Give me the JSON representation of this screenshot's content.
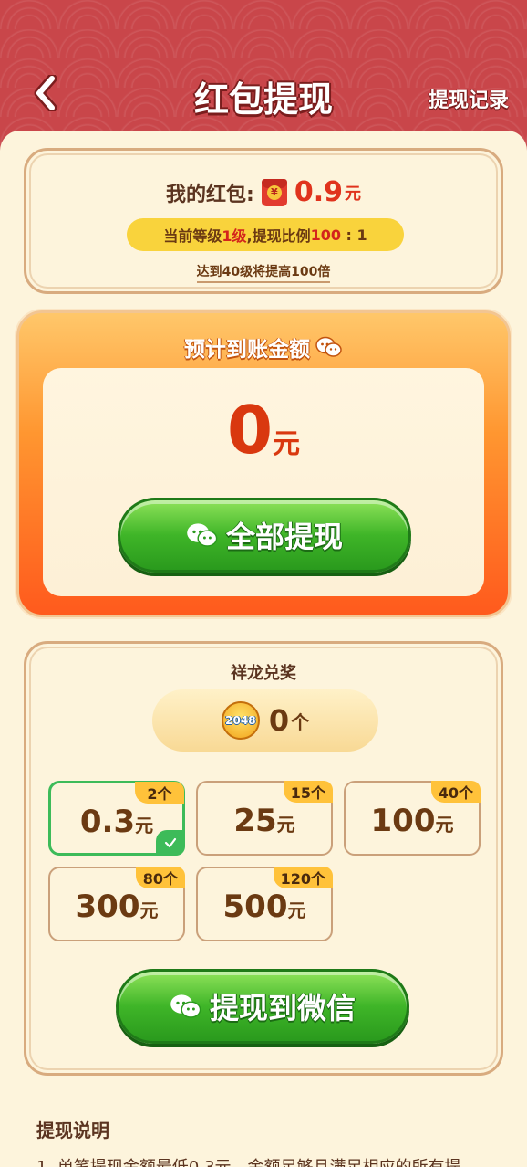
{
  "header": {
    "title": "红包提现",
    "history_label": "提现记录"
  },
  "balance": {
    "label": "我的红包:",
    "icon": "red-packet-icon",
    "amount": "0.9",
    "unit": "元",
    "level_prefix": "当前等级",
    "level_value": "1级",
    "level_mid": ",提现比例",
    "ratio_value": "100",
    "ratio_suffix": " : 1",
    "hint": "达到40级将提高100倍"
  },
  "payout": {
    "title": "预计到账金额",
    "amount": "0",
    "unit": "元",
    "button_label": "全部提现"
  },
  "exchange": {
    "title": "祥龙兑奖",
    "token_icon_text": "2048",
    "token_count": "0",
    "token_unit": "个",
    "options": [
      {
        "cost": "2个",
        "amount": "0.3",
        "unit": "元",
        "selected": true
      },
      {
        "cost": "15个",
        "amount": "25",
        "unit": "元",
        "selected": false
      },
      {
        "cost": "40个",
        "amount": "100",
        "unit": "元",
        "selected": false
      },
      {
        "cost": "80个",
        "amount": "300",
        "unit": "元",
        "selected": false
      },
      {
        "cost": "120个",
        "amount": "500",
        "unit": "元",
        "selected": false
      }
    ],
    "button_label": "提现到微信"
  },
  "notes": {
    "title": "提现说明",
    "line1": "1. 单笔提现金额最低0.3元，金额足够且满足相应的所有提"
  },
  "colors": {
    "header_bg": "#c9464a",
    "accent_red": "#e0331d",
    "green_button": "#3fb528",
    "page_bg": "#fdf4dc",
    "selected_border": "#3dbb59"
  }
}
